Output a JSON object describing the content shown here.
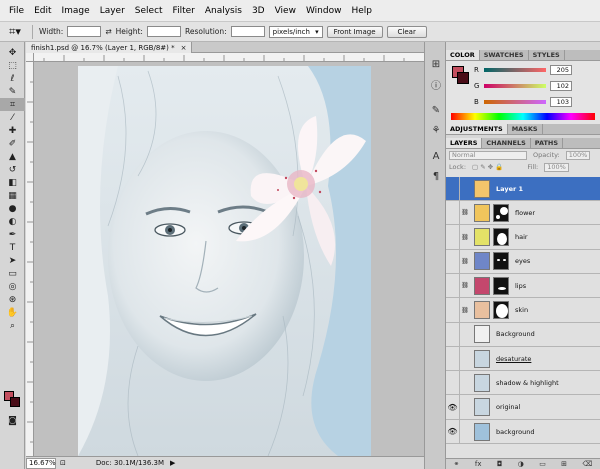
{
  "menu": [
    "File",
    "Edit",
    "Image",
    "Layer",
    "Select",
    "Filter",
    "Analysis",
    "3D",
    "View",
    "Window",
    "Help"
  ],
  "options": {
    "width_label": "Width:",
    "height_label": "Height:",
    "resolution_label": "Resolution:",
    "units": "pixels/inch",
    "front_image": "Front Image",
    "clear": "Clear"
  },
  "document": {
    "tab_title": "finish1.psd @ 16.7% (Layer 1, RGB/8#) *",
    "close": "×"
  },
  "status": {
    "zoom": "16.67%",
    "doc_info": "Doc: 30.1M/136.3M"
  },
  "color_panel": {
    "tabs": [
      "COLOR",
      "SWATCHES",
      "STYLES"
    ],
    "channels": [
      {
        "label": "R",
        "value": "205"
      },
      {
        "label": "G",
        "value": "102"
      },
      {
        "label": "B",
        "value": "103"
      }
    ],
    "foreground": "#c34f5f",
    "background": "#4a0d18"
  },
  "adjust_panel": {
    "tabs": [
      "ADJUSTMENTS",
      "MASKS"
    ]
  },
  "layers_panel": {
    "tabs": [
      "LAYERS",
      "CHANNELS",
      "PATHS"
    ],
    "blend_mode": "Normal",
    "opacity_label": "Opacity:",
    "opacity_value": "100%",
    "lock_label": "Lock:",
    "fill_label": "Fill:",
    "fill_value": "100%",
    "layers": [
      {
        "name": "Layer 1",
        "color": "#f3c56b",
        "selected": true,
        "visible": false,
        "mask": false
      },
      {
        "name": "flower",
        "color": "#f0c55c",
        "selected": false,
        "visible": false,
        "mask": true
      },
      {
        "name": "hair",
        "color": "#e3e267",
        "selected": false,
        "visible": false,
        "mask": true
      },
      {
        "name": "eyes",
        "color": "#6f86c8",
        "selected": false,
        "visible": false,
        "mask": true
      },
      {
        "name": "lips",
        "color": "#c4476d",
        "selected": false,
        "visible": false,
        "mask": true
      },
      {
        "name": "skin",
        "color": "#e9c09f",
        "selected": false,
        "visible": false,
        "mask": true
      },
      {
        "name": "Background",
        "color": "#f0f0f0",
        "selected": false,
        "visible": false,
        "mask": false
      },
      {
        "name": "desaturate",
        "color": "#c8d6e0",
        "selected": false,
        "visible": false,
        "mask": false
      },
      {
        "name": "shadow & highlight",
        "color": "#c8d6e0",
        "selected": false,
        "visible": false,
        "mask": false
      },
      {
        "name": "original",
        "color": "#c8d6e0",
        "selected": false,
        "visible": true,
        "mask": false
      },
      {
        "name": "background",
        "color": "#9fc1db",
        "selected": false,
        "visible": true,
        "mask": false
      }
    ]
  }
}
